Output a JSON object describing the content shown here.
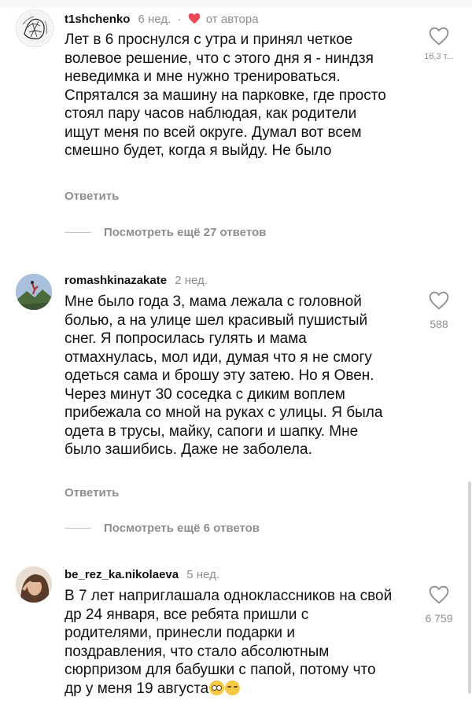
{
  "comments": [
    {
      "username": "t1shchenko",
      "time": "6 нед.",
      "author_liked": "от автора",
      "text": "Лет в 6 проснулся с утра и принял четкое волевое решение, что с этого дня я - ниндзя неведимка и мне нужно тренироваться. Спрятался за машину на парковке, где просто стоял пару часов наблюдая, как родители ищут меня по всей округе. Думал вот всем смешно будет, когда я выйду. Не было",
      "likes": "16,3 т...",
      "reply_label": "Ответить",
      "view_more": "Посмотреть ещё 27 ответов"
    },
    {
      "username": "romashkinazakate",
      "time": "2 нед.",
      "text": "Мне было года 3, мама лежала с головной болью, а на улице шел красивый пушистый снег. Я попросилась гулять и мама отмахнулась, мол иди, думая что я не смогу одеться сама и брошу эту затею. Но я Овен. Через минут 30 соседка с диким воплем прибежала со мной на руках с улицы. Я была одета в трусы, майку, сапоги и шапку. Мне было зашибись. Даже не заболела.",
      "likes": "588",
      "reply_label": "Ответить",
      "view_more": "Посмотреть ещё 6 ответов"
    },
    {
      "username": "be_rez_ka.nikolaeva",
      "time": "5 нед.",
      "text": "В 7 лет наприглашала одноклассников на свой др 24 января, все ребята пришли с родителями, принесли подарки и поздравления, что стало абсолютным сюрпризом для бабушки с папой, потому что др у меня 19 августа",
      "likes": "6 759"
    }
  ],
  "icons": {
    "like": "heart-outline-icon",
    "author_like": "heart-filled-icon",
    "emoji_1": "flushed-face-emoji",
    "emoji_2": "laughing-face-emoji"
  },
  "colors": {
    "text": "#111111",
    "secondary": "#8e8e8e",
    "author_heart": "#ed4956"
  }
}
